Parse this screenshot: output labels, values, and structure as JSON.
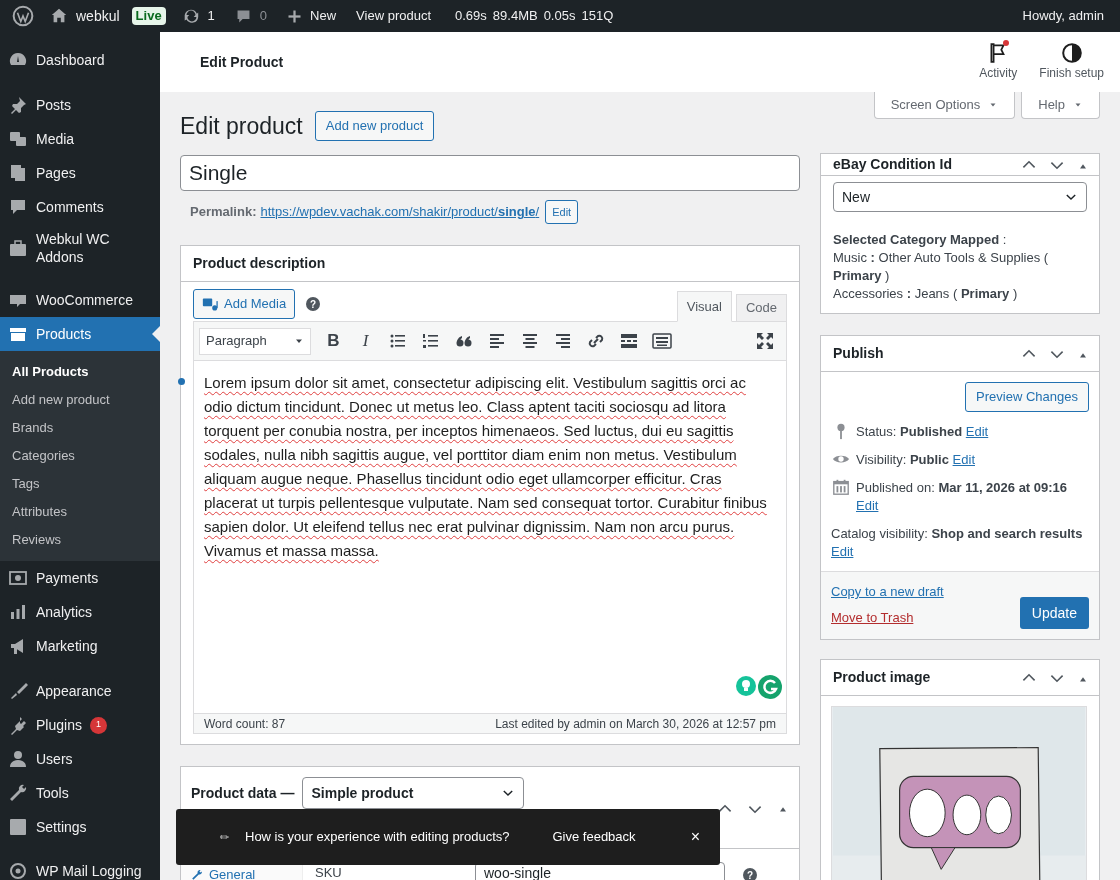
{
  "admin_bar": {
    "site": "webkul",
    "badge": "Live",
    "updates": "1",
    "comments": "0",
    "new": "New",
    "view": "View product",
    "stats": [
      "0.69s",
      "89.4MB",
      "0.05s",
      "151Q"
    ],
    "greeting": "Howdy, admin"
  },
  "sidebar": {
    "items": [
      {
        "label": "Dashboard",
        "selected": false
      },
      {
        "label": "Posts",
        "selected": false,
        "separator_before": true
      },
      {
        "label": "Media",
        "selected": false
      },
      {
        "label": "Pages",
        "selected": false
      },
      {
        "label": "Comments",
        "selected": false
      },
      {
        "label": "Webkul WC Addons",
        "selected": false
      },
      {
        "label": "WooCommerce",
        "selected": false,
        "separator_before": true
      },
      {
        "label": "Products",
        "selected": true,
        "children": [
          {
            "label": "All Products",
            "selected": true
          },
          {
            "label": "Add new product",
            "selected": false
          },
          {
            "label": "Brands",
            "selected": false
          },
          {
            "label": "Categories",
            "selected": false
          },
          {
            "label": "Tags",
            "selected": false
          },
          {
            "label": "Attributes",
            "selected": false
          },
          {
            "label": "Reviews",
            "selected": false
          }
        ]
      },
      {
        "label": "Payments",
        "selected": false
      },
      {
        "label": "Analytics",
        "selected": false
      },
      {
        "label": "Marketing",
        "selected": false
      },
      {
        "label": "Appearance",
        "selected": false,
        "separator_before": true
      },
      {
        "label": "Plugins",
        "selected": false,
        "badge": "1"
      },
      {
        "label": "Users",
        "selected": false
      },
      {
        "label": "Tools",
        "selected": false
      },
      {
        "label": "Settings",
        "selected": false
      },
      {
        "label": "WP Mail Logging",
        "selected": false,
        "separator_before": true
      }
    ]
  },
  "header": {
    "title": "Edit Product",
    "actions": [
      {
        "label": "Activity",
        "notification": true
      },
      {
        "label": "Finish setup",
        "notification": false
      }
    ]
  },
  "screen_tabs": [
    "Screen Options",
    "Help"
  ],
  "page": {
    "heading": "Edit product",
    "add_new": "Add new product",
    "title_value": "Single",
    "permalink": {
      "label": "Permalink:",
      "url": "https://wpdev.vachak.com/shakir/product/**single**/",
      "edit": "Edit"
    }
  },
  "description": {
    "title": "Product description",
    "add_media": "Add Media",
    "help": "?",
    "tabs": [
      {
        "label": "Visual",
        "selected": true
      },
      {
        "label": "Code",
        "selected": false
      }
    ],
    "toolbar": {
      "format": "Paragraph",
      "bold": "B",
      "italic": "I"
    },
    "content": "Lorem ipsum dolor sit amet, consectetur adipiscing elit. Vestibulum sagittis orci ac odio dictum tincidunt. Donec ut metus leo. Class aptent taciti sociosqu ad litora torquent per conubia nostra, per inceptos himenaeos. Sed luctus, dui eu sagittis sodales, nulla nibh sagittis augue, vel porttitor diam enim non metus. Vestibulum aliquam augue neque. Phasellus tincidunt odio eget ullamcorper efficitur. Cras placerat ut turpis pellentesque vulputate. Nam sed consequat tortor. Curabitur finibus sapien dolor. Ut eleifend tellus nec erat pulvinar dignissim. Nam non arcu purus. Vivamus et massa massa.",
    "word_count": "Word count: 87",
    "last_edited": "Last edited by admin on March 30, 2026 at 12:57 pm"
  },
  "product_data": {
    "title": "Product data —",
    "type": "Simple product",
    "tabs": [
      {
        "label": "General",
        "selected": true
      }
    ],
    "sku_label": "SKU",
    "sku_value": "woo-single",
    "help": "?"
  },
  "toast": {
    "icon": "✏",
    "message": "How is your experience with editing products?",
    "action": "Give feedback",
    "close": "×"
  },
  "ebay": {
    "title": "eBay Condition Id",
    "condition": "New",
    "mapped_label": "**Selected Category Mapped** :",
    "mappings": [
      "Music **:** Other Auto Tools & Supplies ( **Primary** )",
      "Accessories **:** Jeans ( **Primary** )"
    ]
  },
  "publish": {
    "title": "Publish",
    "preview": "Preview Changes",
    "rows": [
      {
        "text": "Status: **Published**",
        "link": "Edit"
      },
      {
        "text": "Visibility: **Public**",
        "link": "Edit"
      },
      {
        "text": "Published on: **Mar 11, 2026 at 09:16**",
        "link": "Edit"
      },
      {
        "text": "Catalog visibility: **Shop and search results**",
        "link": "Edit"
      }
    ],
    "copy": "Copy to a new draft",
    "trash": "Move to Trash",
    "update": "Update"
  },
  "product_image": {
    "title": "Product image"
  }
}
